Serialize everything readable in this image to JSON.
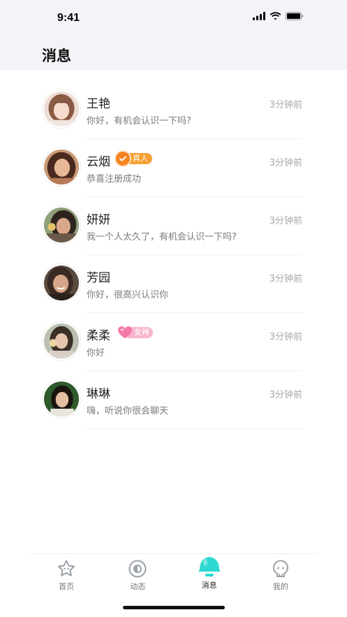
{
  "status_bar": {
    "time": "9:41"
  },
  "header": {
    "title": "消息"
  },
  "messages": [
    {
      "name": "王艳",
      "preview": "你好，有机会认识一下吗?",
      "time": "3分钟前",
      "badge": null
    },
    {
      "name": "云烟",
      "preview": "恭喜注册成功",
      "time": "3分钟前",
      "badge": "真人"
    },
    {
      "name": "妍妍",
      "preview": "我一个人太久了，有机会认识一下吗?",
      "time": "3分钟前",
      "badge": null
    },
    {
      "name": "芳园",
      "preview": "你好，很高兴认识你",
      "time": "3分钟前",
      "badge": null
    },
    {
      "name": "柔柔",
      "preview": "你好",
      "time": "3分钟前",
      "badge": "女神"
    },
    {
      "name": "琳琳",
      "preview": "嗨，听说你很会聊天",
      "time": "3分钟前",
      "badge": null
    }
  ],
  "tabbar": {
    "items": [
      {
        "label": "首页",
        "icon": "star-icon",
        "active": false
      },
      {
        "label": "动态",
        "icon": "eye-icon",
        "active": false
      },
      {
        "label": "消息",
        "icon": "bell-icon",
        "active": true
      },
      {
        "label": "我的",
        "icon": "ghost-icon",
        "active": false
      }
    ]
  },
  "colors": {
    "accent": "#2dd9d2",
    "real_badge": "#f5a133",
    "goddess_badge": "#f9b6cf",
    "header_bg": "#f3f4f8"
  }
}
